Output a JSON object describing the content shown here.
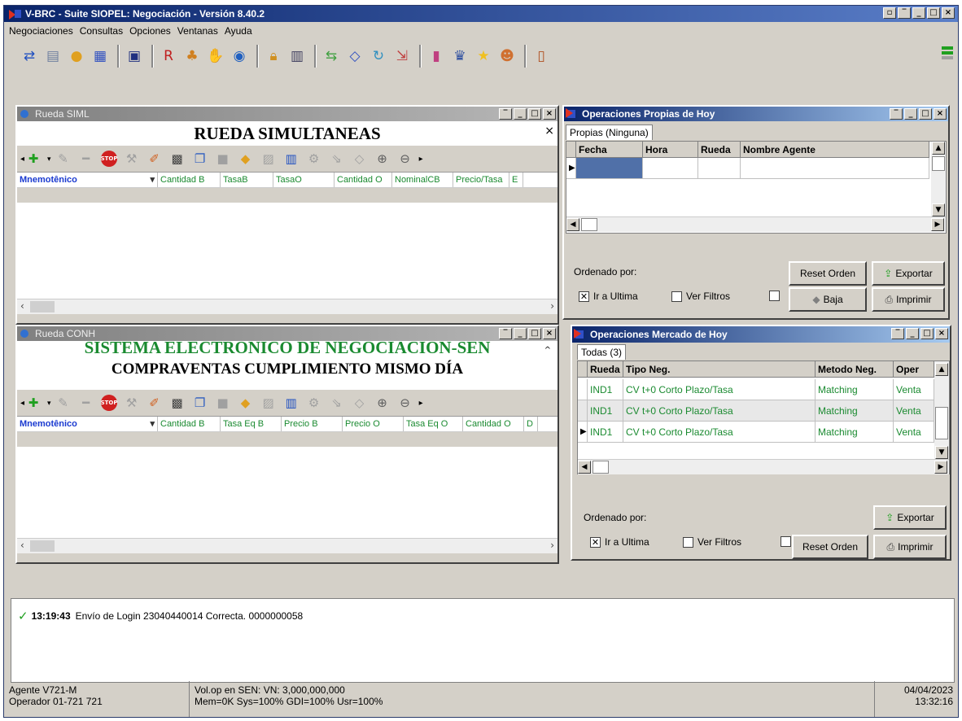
{
  "window": {
    "title": "V-BRC - Suite SIOPEL: Negociación - Versión 8.40.2"
  },
  "menu": [
    "Negociaciones",
    "Consultas",
    "Opciones",
    "Ventanas",
    "Ayuda"
  ],
  "rueda_siml": {
    "title": "Rueda SIML",
    "heading": "RUEDA SIMULTANEAS",
    "first_col": "Mnemotênico",
    "columns": [
      "Cantidad B",
      "TasaB",
      "TasaO",
      "Cantidad O",
      "NominalCB",
      "Precio/Tasa",
      "E"
    ]
  },
  "rueda_conh": {
    "title": "Rueda CONH",
    "heading1": "SISTEMA ELECTRONICO DE NEGOCIACION-SEN",
    "heading2": "COMPRAVENTAS CUMPLIMIENTO MISMO DÍA",
    "first_col": "Mnemotênico",
    "columns": [
      "Cantidad B",
      "Tasa Eq B",
      "Precio B",
      "Precio O",
      "Tasa Eq O",
      "Cantidad O",
      "D"
    ]
  },
  "ops_propias": {
    "title": "Operaciones Propias de Hoy",
    "tab": "Propias (Ninguna)",
    "columns": [
      "Fecha",
      "Hora",
      "Rueda",
      "Nombre Agente"
    ],
    "ordenado": "Ordenado por:",
    "ir_ultima": "Ir a Ultima",
    "ver_filtros": "Ver Filtros",
    "btn_reset": "Reset Orden",
    "btn_exportar": "Exportar",
    "btn_baja": "Baja",
    "btn_imprimir": "Imprimir"
  },
  "ops_mercado": {
    "title": "Operaciones Mercado de Hoy",
    "tab": "Todas (3)",
    "columns": [
      "Rueda",
      "Tipo Neg.",
      "Metodo Neg.",
      "Oper"
    ],
    "rows": [
      [
        "IND1",
        "CV t+0 Corto Plazo/Tasa",
        "Matching",
        "Venta"
      ],
      [
        "IND1",
        "CV t+0 Corto Plazo/Tasa",
        "Matching",
        "Venta"
      ],
      [
        "IND1",
        "CV t+0 Corto Plazo/Tasa",
        "Matching",
        "Venta"
      ]
    ],
    "ordenado": "Ordenado por:",
    "ir_ultima": "Ir a Ultima",
    "ver_filtros": "Ver Filtros",
    "btn_exportar": "Exportar",
    "btn_reset": "Reset Orden",
    "btn_imprimir": "Imprimir"
  },
  "log": {
    "time": "13:19:43",
    "message": "Envío de Login 23040440014 Correcta. 0000000058"
  },
  "status": {
    "agente": "Agente V721-M",
    "operador": "Operador 01-721 721",
    "volop": "Vol.op en SEN:  VN: 3,000,000,000",
    "mem": "Mem=0K Sys=100% GDI=100% Usr=100%",
    "date": "04/04/2023",
    "time": "13:32:16"
  }
}
